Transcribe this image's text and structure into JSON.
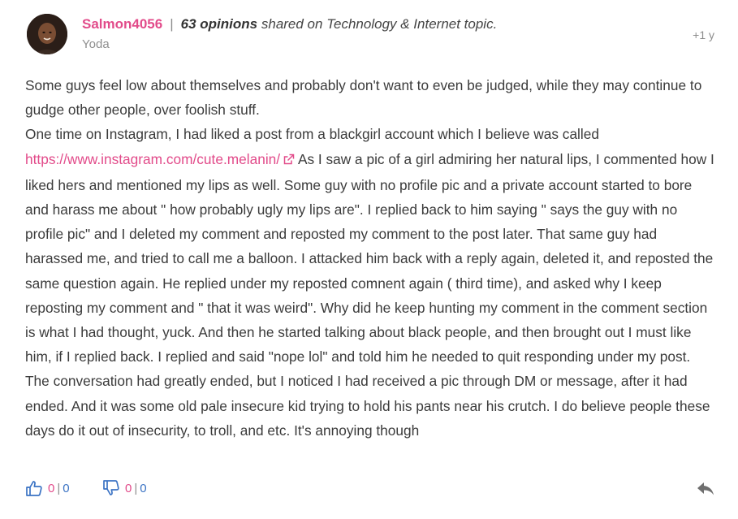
{
  "author": {
    "username": "Salmon4056",
    "opinions_count": "63 opinions",
    "shared_text": "shared on Technology & Internet topic.",
    "subtitle": "Yoda"
  },
  "timestamp": "+1 y",
  "post": {
    "para1": "Some guys feel low about themselves and probably don't want to even be judged, while they may continue to gudge other people, over foolish stuff.",
    "para2_before_link": "One time on Instagram, I had liked a post from a blackgirl account which I believe was called",
    "link_text": "https://www.instagram.com/cute.melanin/",
    "para2_after_link": "As I saw a pic of a girl admiring her natural lips, I commented how I liked hers and mentioned my lips as well. Some guy with no profile pic and a private account started to bore and harass me about \" how probably ugly my lips are\". I replied back to him saying \" says the guy with no profile pic\" and I deleted my comment and reposted my comment to the post later. That same guy had harassed me, and tried to call me a balloon. I attacked him back with a reply again, deleted it, and reposted the same question again. He replied under my reposted comnent again ( third time), and asked why I keep reposting my comment and \" that it was weird\". Why did he keep hunting my comment in the comment section is what I had thought, yuck. And then he started talking about black people, and then brought out I must like him, if I replied back. I replied and said \"nope lol\" and told him he needed to quit responding under my post. The conversation had greatly ended, but I noticed I had received a pic through DM or message, after it had ended. And it was some old pale insecure kid trying to hold his pants near his crutch. I do believe people these days do it out of insecurity, to troll, and etc. It's annoying though"
  },
  "votes": {
    "up": {
      "a": "0",
      "sep": "|",
      "b": "0"
    },
    "down": {
      "a": "0",
      "sep": "|",
      "b": "0"
    }
  },
  "icons": {
    "thumbs_up": "thumbs-up-icon",
    "thumbs_down": "thumbs-down-icon",
    "reply": "reply-icon",
    "external_link": "external-link-icon"
  },
  "colors": {
    "accent": "#e24b8a",
    "icon_blue": "#3b73c4",
    "text": "#3b3b3b",
    "muted": "#8d8d8d"
  }
}
